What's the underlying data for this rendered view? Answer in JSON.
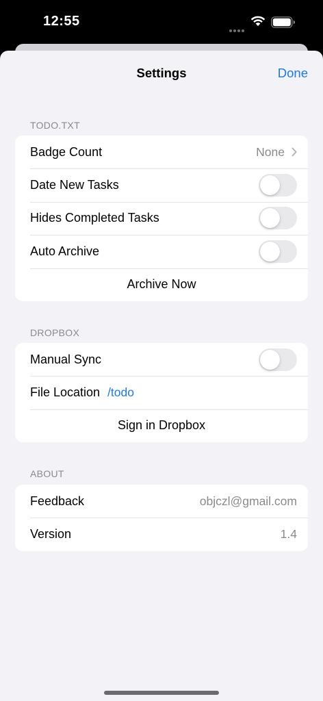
{
  "status": {
    "time": "12:55"
  },
  "nav": {
    "title": "Settings",
    "done_label": "Done"
  },
  "sections": {
    "todo": {
      "header": "TODO.TXT",
      "badge_count": {
        "label": "Badge Count",
        "value": "None"
      },
      "date_new_tasks": {
        "label": "Date New Tasks",
        "on": false
      },
      "hides_completed": {
        "label": "Hides Completed Tasks",
        "on": false
      },
      "auto_archive": {
        "label": "Auto Archive",
        "on": false
      },
      "archive_now": {
        "label": "Archive Now"
      }
    },
    "dropbox": {
      "header": "DROPBOX",
      "manual_sync": {
        "label": "Manual Sync",
        "on": false
      },
      "file_location": {
        "label": "File Location",
        "value": "/todo"
      },
      "sign_in": {
        "label": "Sign in Dropbox"
      }
    },
    "about": {
      "header": "ABOUT",
      "feedback": {
        "label": "Feedback",
        "value": "objczl@gmail.com"
      },
      "version": {
        "label": "Version",
        "value": "1.4"
      }
    }
  },
  "colors": {
    "accent": "#1f7ae0",
    "background": "#f2f2f7",
    "secondary_text": "#8a8a8e"
  },
  "icons": [
    "wifi-icon",
    "battery-icon",
    "chevron-right-icon"
  ]
}
